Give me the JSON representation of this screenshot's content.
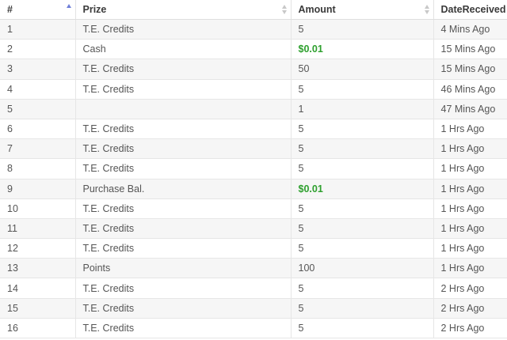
{
  "table": {
    "columns": [
      "#",
      "Prize",
      "Amount",
      "DateReceived"
    ],
    "sort": {
      "column": "#",
      "direction": "asc"
    },
    "accent_color": "#6f7fd8",
    "money_color": "#2ea02e",
    "rows": [
      {
        "num": "1",
        "prize": "T.E. Credits",
        "amount": "5",
        "date": "4 Mins Ago",
        "money": false
      },
      {
        "num": "2",
        "prize": "Cash",
        "amount": "$0.01",
        "date": "15 Mins Ago",
        "money": true
      },
      {
        "num": "3",
        "prize": "T.E. Credits",
        "amount": "50",
        "date": "15 Mins Ago",
        "money": false
      },
      {
        "num": "4",
        "prize": "T.E. Credits",
        "amount": "5",
        "date": "46 Mins Ago",
        "money": false
      },
      {
        "num": "5",
        "prize": "",
        "amount": "1",
        "date": "47 Mins Ago",
        "money": false
      },
      {
        "num": "6",
        "prize": "T.E. Credits",
        "amount": "5",
        "date": "1 Hrs Ago",
        "money": false
      },
      {
        "num": "7",
        "prize": "T.E. Credits",
        "amount": "5",
        "date": "1 Hrs Ago",
        "money": false
      },
      {
        "num": "8",
        "prize": "T.E. Credits",
        "amount": "5",
        "date": "1 Hrs Ago",
        "money": false
      },
      {
        "num": "9",
        "prize": "Purchase Bal.",
        "amount": "$0.01",
        "date": "1 Hrs Ago",
        "money": true
      },
      {
        "num": "10",
        "prize": "T.E. Credits",
        "amount": "5",
        "date": "1 Hrs Ago",
        "money": false
      },
      {
        "num": "11",
        "prize": "T.E. Credits",
        "amount": "5",
        "date": "1 Hrs Ago",
        "money": false
      },
      {
        "num": "12",
        "prize": "T.E. Credits",
        "amount": "5",
        "date": "1 Hrs Ago",
        "money": false
      },
      {
        "num": "13",
        "prize": "Points",
        "amount": "100",
        "date": "1 Hrs Ago",
        "money": false
      },
      {
        "num": "14",
        "prize": "T.E. Credits",
        "amount": "5",
        "date": "2 Hrs Ago",
        "money": false
      },
      {
        "num": "15",
        "prize": "T.E. Credits",
        "amount": "5",
        "date": "2 Hrs Ago",
        "money": false
      },
      {
        "num": "16",
        "prize": "T.E. Credits",
        "amount": "5",
        "date": "2 Hrs Ago",
        "money": false
      }
    ]
  }
}
